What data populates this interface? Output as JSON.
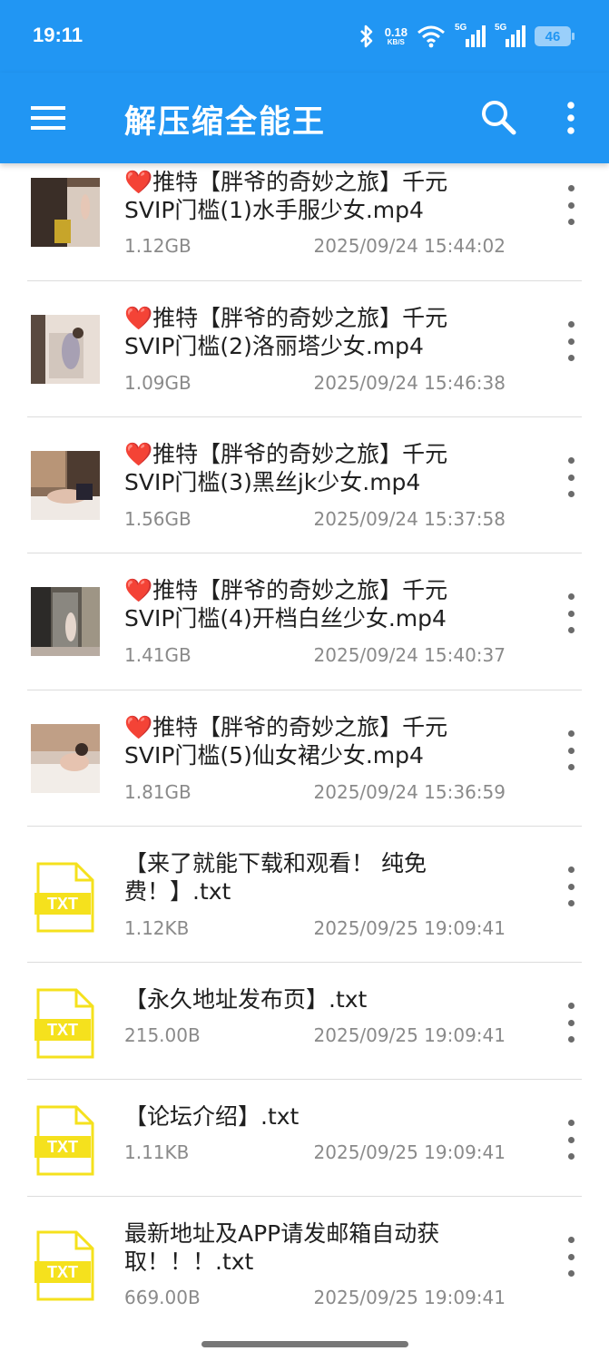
{
  "status_bar": {
    "time": "19:11",
    "net_speed": "0.18",
    "net_unit": "KB/S",
    "signal_1_label": "5G",
    "signal_2_label": "5G",
    "battery": "46",
    "icons": [
      "bluetooth-icon",
      "wifi-icon",
      "signal-5g-icon",
      "signal-5g-icon",
      "battery-icon"
    ]
  },
  "app_bar": {
    "title": "解压缩全能王",
    "icons": [
      "menu-icon",
      "search-icon",
      "more-vertical-icon"
    ]
  },
  "colors": {
    "primary": "#2196f3",
    "txt_icon": "#f5e11d",
    "name_text": "#1f1f1f",
    "meta_text": "#8a8a8a"
  },
  "files": [
    {
      "type": "video",
      "name": "❤️推特【胖爷的奇妙之旅】千元\nSVIP门槛(1)水手服少女.mp4",
      "size": "1.12GB",
      "date": "2025/09/24 15:44:02"
    },
    {
      "type": "video",
      "name": "❤️推特【胖爷的奇妙之旅】千元\nSVIP门槛(2)洛丽塔少女.mp4",
      "size": "1.09GB",
      "date": "2025/09/24 15:46:38"
    },
    {
      "type": "video",
      "name": "❤️推特【胖爷的奇妙之旅】千元\nSVIP门槛(3)黑丝jk少女.mp4",
      "size": "1.56GB",
      "date": "2025/09/24 15:37:58"
    },
    {
      "type": "video",
      "name": "❤️推特【胖爷的奇妙之旅】千元\nSVIP门槛(4)开档白丝少女.mp4",
      "size": "1.41GB",
      "date": "2025/09/24 15:40:37"
    },
    {
      "type": "video",
      "name": "❤️推特【胖爷的奇妙之旅】千元\nSVIP门槛(5)仙女裙少女.mp4",
      "size": "1.81GB",
      "date": "2025/09/24 15:36:59"
    },
    {
      "type": "txt",
      "icon_label": "TXT",
      "name": "【来了就能下载和观看！ 纯免\n费！】.txt",
      "size": "1.12KB",
      "date": "2025/09/25 19:09:41"
    },
    {
      "type": "txt",
      "icon_label": "TXT",
      "name": "【永久地址发布页】.txt",
      "size": "215.00B",
      "date": "2025/09/25 19:09:41"
    },
    {
      "type": "txt",
      "icon_label": "TXT",
      "name": "【论坛介绍】.txt",
      "size": "1.11KB",
      "date": "2025/09/25 19:09:41"
    },
    {
      "type": "txt",
      "icon_label": "TXT",
      "name": "最新地址及APP请发邮箱自动获\n取！！！.txt",
      "size": "669.00B",
      "date": "2025/09/25 19:09:41"
    }
  ]
}
